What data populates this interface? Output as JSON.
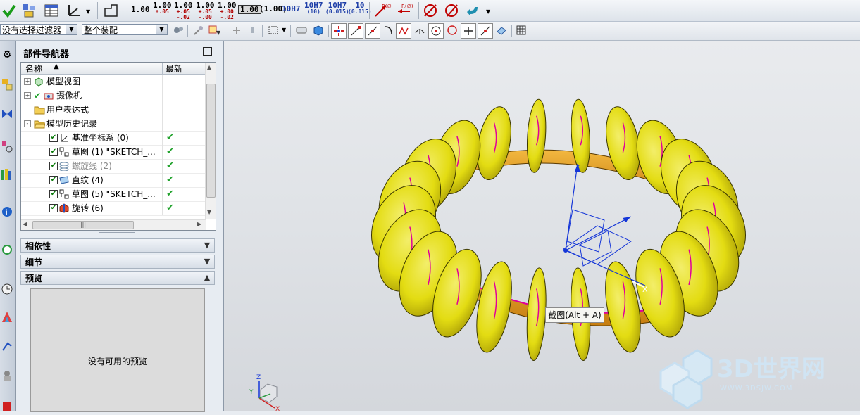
{
  "toolbar1": {
    "tolerances": [
      {
        "main": "1.00",
        "upper": "",
        "lower": "",
        "style": "plain"
      },
      {
        "main": "1.00",
        "upper": "±.05",
        "lower": "",
        "style": "red"
      },
      {
        "main": "1.00",
        "upper": "+.05",
        "lower": "-.02",
        "style": "red"
      },
      {
        "main": "1.00",
        "upper": "+.05",
        "lower": "-.00",
        "style": "red"
      },
      {
        "main": "1.00",
        "upper": "+.00",
        "lower": "-.02",
        "style": "red"
      }
    ],
    "boxed_value": "1.00",
    "paren_value": "(1.00)",
    "fit_labels": [
      {
        "main": "10H7",
        "sub": ""
      },
      {
        "main": "10H7",
        "sub": "(10)"
      },
      {
        "main": "10H7",
        "sub": "(0.015)"
      },
      {
        "main": "10",
        "sub": "(0.015)"
      }
    ],
    "radius_labels": [
      "R(∅)",
      "R(∅)"
    ]
  },
  "toolbar2": {
    "filter_combo": "没有选择过滤器",
    "assembly_combo": "整个装配"
  },
  "navigator": {
    "title": "部件导航器",
    "col_name": "名称",
    "col_latest": "最新",
    "rows": [
      {
        "label": "模型视图",
        "expand": "+",
        "checked": false,
        "latest": false,
        "grey": false
      },
      {
        "label": "摄像机",
        "expand": "+",
        "checked": false,
        "latest": false,
        "grey": false
      },
      {
        "label": "用户表达式",
        "expand": "",
        "checked": false,
        "latest": false,
        "grey": false
      },
      {
        "label": "模型历史记录",
        "expand": "-",
        "checked": false,
        "latest": false,
        "grey": false
      },
      {
        "label": "基准坐标系 (0)",
        "expand": "",
        "checked": true,
        "latest": true,
        "grey": false
      },
      {
        "label": "草图 (1) \"SKETCH_...",
        "expand": "",
        "checked": true,
        "latest": true,
        "grey": false
      },
      {
        "label": "螺旋线 (2)",
        "expand": "",
        "checked": true,
        "latest": true,
        "grey": true
      },
      {
        "label": "直纹 (4)",
        "expand": "",
        "checked": true,
        "latest": true,
        "grey": false
      },
      {
        "label": "草图 (5) \"SKETCH_...",
        "expand": "",
        "checked": true,
        "latest": true,
        "grey": false
      },
      {
        "label": "旋转 (6)",
        "expand": "",
        "checked": true,
        "latest": true,
        "grey": false
      }
    ],
    "scroll_grip": "|||",
    "sections": [
      "相依性",
      "细节",
      "预览"
    ],
    "preview_empty": "没有可用的预览"
  },
  "viewport": {
    "tooltip": "截图(Alt + A)",
    "axis_z": "Z",
    "axis_y": "Y",
    "axis_x": "X",
    "triad_z": "Z",
    "triad_y": "Y",
    "triad_x": "X",
    "watermark_brand": "3D世界网",
    "watermark_url": "WWW.3DSJW.COM"
  },
  "colors": {
    "disc_yellow": "#e3dc12",
    "ring_orange": "#e7a020",
    "magenta_edge": "#e0009a",
    "csys_blue": "#1536d8",
    "watermark": "#cfe6f7"
  }
}
